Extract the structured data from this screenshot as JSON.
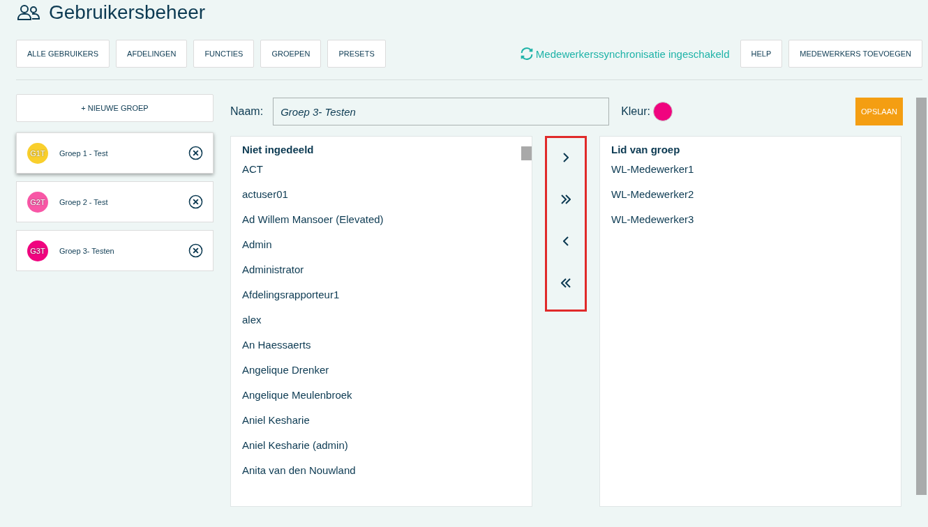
{
  "header": {
    "title": "Gebruikersbeheer"
  },
  "nav_buttons": [
    {
      "label": "ALLE GEBRUIKERS"
    },
    {
      "label": "AFDELINGEN"
    },
    {
      "label": "FUNCTIES"
    },
    {
      "label": "GROEPEN"
    },
    {
      "label": "PRESETS"
    }
  ],
  "sync_status": "Medewerkerssynchronisatie ingeschakeld",
  "action_buttons": [
    {
      "label": "HELP"
    },
    {
      "label": "MEDEWERKERS TOEVOEGEN"
    }
  ],
  "new_group_button": "+ NIEUWE GROEP",
  "groups": [
    {
      "initials": "G1T",
      "name": "Groep 1 - Test",
      "color": "#f9cf2c",
      "selected": true
    },
    {
      "initials": "G2T",
      "name": "Groep 2 - Test",
      "color": "#f857a6",
      "selected": false
    },
    {
      "initials": "G3T",
      "name": "Groep 3- Testen",
      "color": "#f0047f",
      "selected": false
    }
  ],
  "editor": {
    "name_label": "Naam:",
    "name_value": "Groep 3- Testen",
    "color_label": "Kleur:",
    "color": "#f0047f",
    "save_button": "OPSLAAN"
  },
  "unassigned": {
    "title": "Niet ingedeeld",
    "items": [
      "ACT",
      "actuser01",
      "Ad Willem Mansoer (Elevated)",
      "Admin",
      "Administrator",
      "Afdelingsrapporteur1",
      "alex",
      "An Haessaerts",
      "Angelique Drenker",
      "Angelique Meulenbroek",
      "Aniel Kesharie",
      "Aniel Kesharie (admin)",
      "Anita van den Nouwland"
    ]
  },
  "transfer_buttons": [
    {
      "kind": "one-right"
    },
    {
      "kind": "all-right"
    },
    {
      "kind": "one-left"
    },
    {
      "kind": "all-left"
    }
  ],
  "members": {
    "title": "Lid van groep",
    "items": [
      "WL-Medewerker1",
      "WL-Medewerker2",
      "WL-Medewerker3"
    ]
  }
}
